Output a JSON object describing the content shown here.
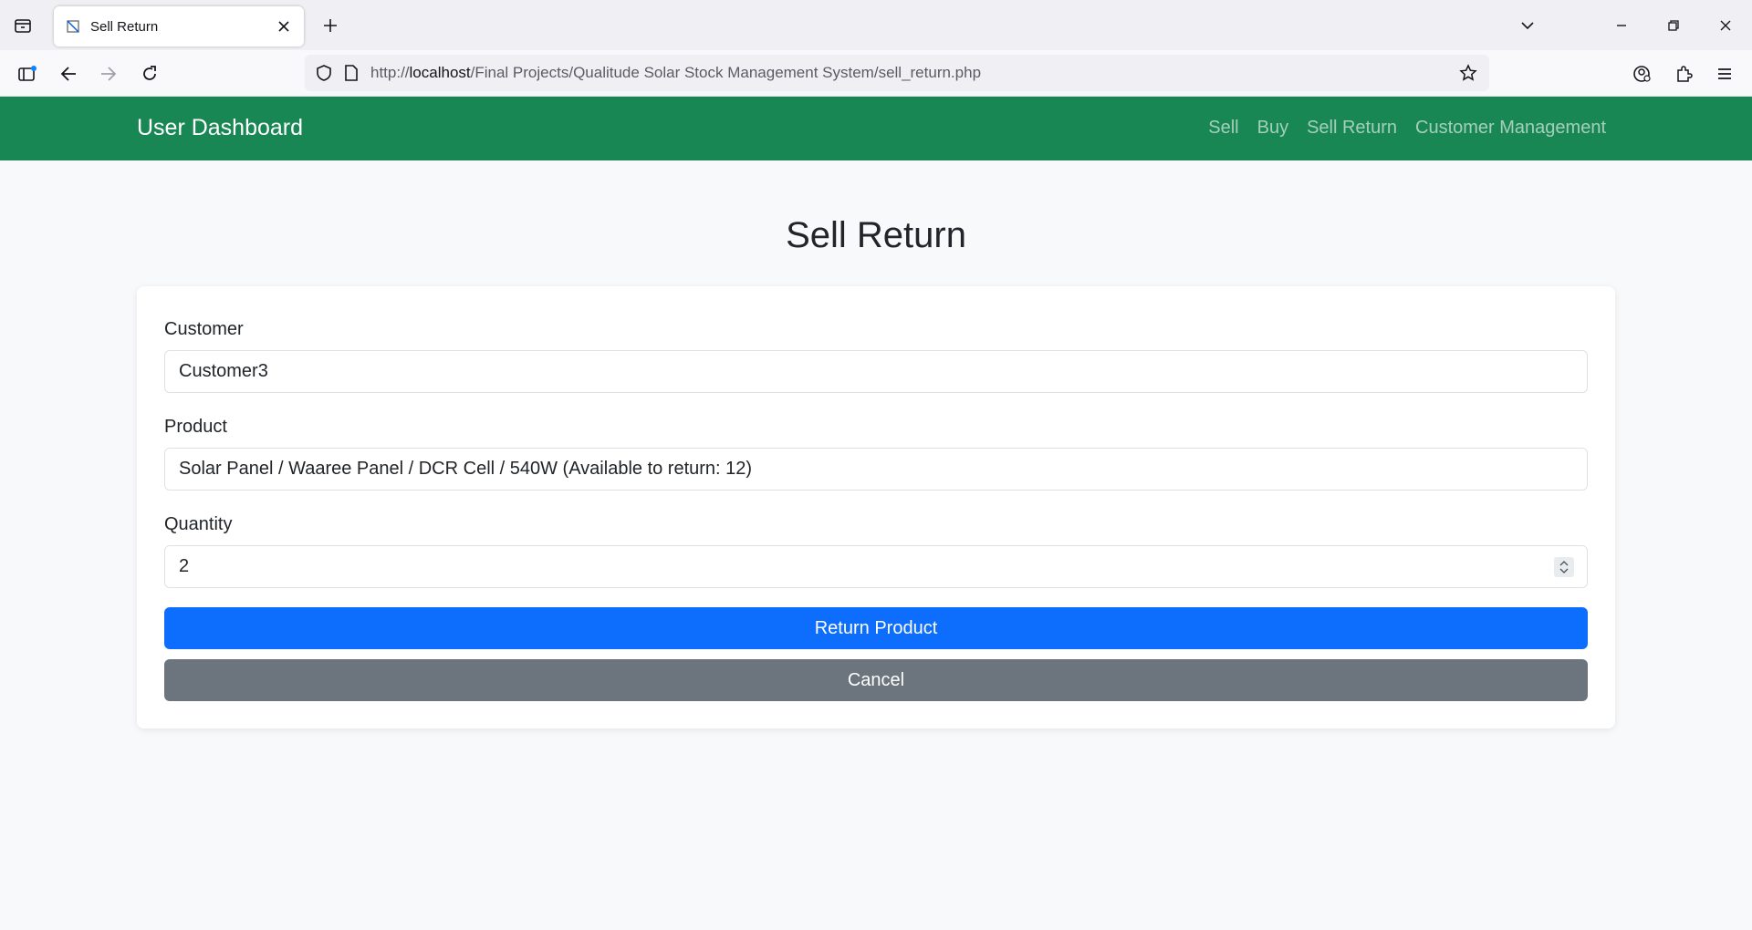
{
  "browser": {
    "tab_title": "Sell Return",
    "url_prefix": "http://",
    "url_host": "localhost",
    "url_path": "/Final Projects/Qualitude Solar Stock Management System/sell_return.php"
  },
  "navbar": {
    "brand": "User Dashboard",
    "links": [
      "Sell",
      "Buy",
      "Sell Return",
      "Customer Management"
    ],
    "bg_color": "#198754"
  },
  "page": {
    "title": "Sell Return"
  },
  "form": {
    "customer_label": "Customer",
    "customer_value": "Customer3",
    "product_label": "Product",
    "product_value": "Solar Panel / Waaree Panel / DCR Cell / 540W (Available to return: 12)",
    "quantity_label": "Quantity",
    "quantity_value": "2",
    "submit_label": "Return Product",
    "cancel_label": "Cancel",
    "submit_color": "#0d6efd",
    "cancel_color": "#6c757d"
  }
}
